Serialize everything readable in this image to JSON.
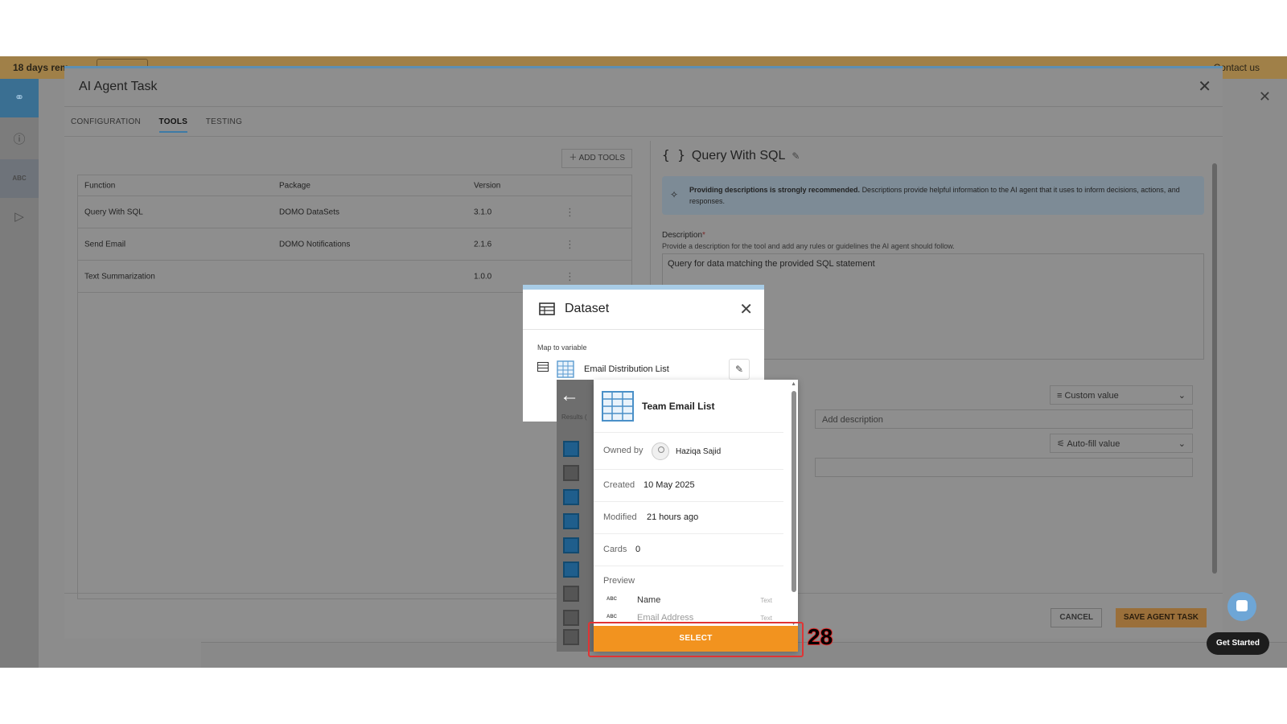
{
  "trial": {
    "text": "18 days rem",
    "contact": "Contact us"
  },
  "agent_modal": {
    "title": "AI Agent Task",
    "tabs": [
      {
        "label": "CONFIGURATION",
        "active": false
      },
      {
        "label": "TOOLS",
        "active": true
      },
      {
        "label": "TESTING",
        "active": false
      }
    ],
    "add_tools_label": "ADD TOOLS",
    "table": {
      "headers": [
        "Function",
        "Package",
        "Version"
      ],
      "rows": [
        {
          "function": "Query With SQL",
          "package": "DOMO DataSets",
          "version": "3.1.0"
        },
        {
          "function": "Send Email",
          "package": "DOMO Notifications",
          "version": "2.1.6"
        },
        {
          "function": "Text Summarization",
          "package": "",
          "version": "1.0.0"
        }
      ]
    },
    "tool_detail": {
      "title": "Query With SQL",
      "info_bold": "Providing descriptions is strongly recommended.",
      "info_text": "Descriptions provide helpful information to the AI agent that it uses to inform decisions, actions, and responses.",
      "description_label": "Description",
      "description_help": "Provide a description for the tool and add any rules or guidelines the AI agent should follow.",
      "description_value": "Query for data matching the provided SQL statement",
      "custom_value_label": "Custom value",
      "add_description_placeholder": "Add description",
      "autofill_label": "Auto-fill value"
    },
    "cancel_label": "CANCEL",
    "save_label": "SAVE AGENT TASK"
  },
  "dataset_dialog": {
    "title": "Dataset",
    "map_label": "Map to variable",
    "variable_name": "Email Distribution List"
  },
  "results": {
    "label": "Results ("
  },
  "dataset_card": {
    "name": "Team Email List",
    "owned_by_label": "Owned by",
    "owner": "Haziqa Sajid",
    "created_label": "Created",
    "created": "10 May 2025",
    "modified_label": "Modified",
    "modified": "21 hours ago",
    "cards_label": "Cards",
    "cards": "0",
    "preview_label": "Preview",
    "columns": [
      {
        "abc": "ABC",
        "name": "Name",
        "type": "Text"
      },
      {
        "abc": "ABC",
        "name": "Email Address",
        "type": "Text"
      }
    ]
  },
  "select_label": "SELECT",
  "step_number": "28",
  "chat": {
    "get_started": "Get Started"
  },
  "colors": {
    "accent_orange": "#f2931f",
    "highlight_red": "#e03434",
    "brand_blue": "#3d7aa6"
  }
}
